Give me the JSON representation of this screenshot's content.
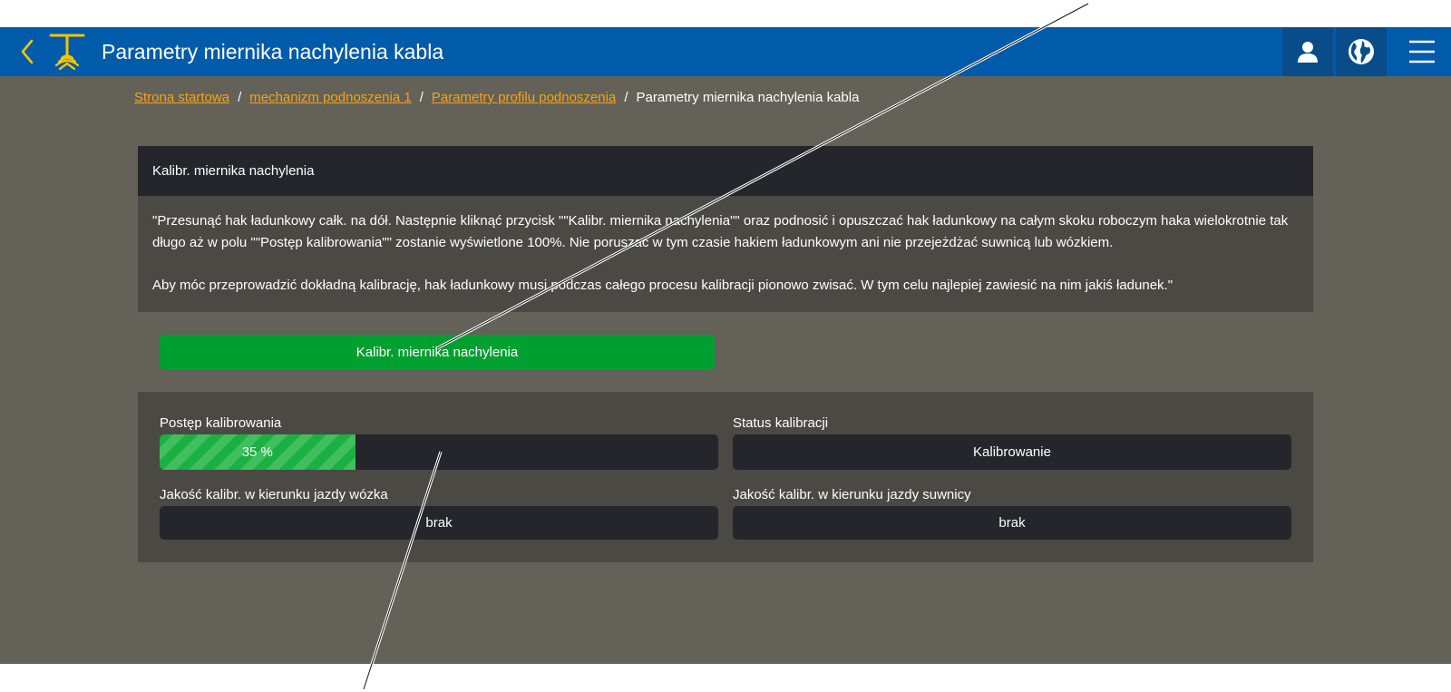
{
  "header": {
    "title": "Parametry miernika nachylenia kabla",
    "background_color": "#005baa",
    "icons": {
      "back": "chevron-left-icon",
      "logo": "crane-hook-icon",
      "user": "user-icon",
      "globe": "globe-icon",
      "menu": "hamburger-menu-icon"
    }
  },
  "breadcrumb": {
    "items": [
      "Strona startowa",
      "mechanizm podnoszenia 1",
      "Parametry profilu podnoszenia"
    ],
    "current": "Parametry miernika nachylenia kabla",
    "separator": "/",
    "link_color": "#f2a41d"
  },
  "info_card": {
    "title": "Kalibr. miernika nachylenia",
    "paragraph1": "\"Przesunąć hak ładunkowy całk. na dół. Następnie kliknąć przycisk \"\"Kalibr. miernika nachylenia\"\" oraz podnosić i opuszczać hak ładunkowy na całym skoku roboczym haka wielokrotnie tak długo aż w polu \"\"Postęp kalibrowania\"\" zostanie wyświetlone 100%. Nie poruszać w tym czasie hakiem ładunkowym ani nie przejeżdżać suwnicą lub wózkiem.",
    "paragraph2": "Aby móc przeprowadzić dokładną kalibrację, hak ładunkowy musi podczas całego procesu kalibracji pionowo zwisać. W tym celu najlepiej zawiesić na nim jakiś ładunek.\""
  },
  "calibrate_button": {
    "label": "Kalibr. miernika nachylenia",
    "color": "#00a030"
  },
  "status": {
    "progress_label": "Postęp kalibrowania",
    "progress_percent": 35,
    "progress_text": "35 %",
    "status_label": "Status kalibracji",
    "status_value": "Kalibrowanie",
    "trolley_quality_label": "Jakość kalibr. w kierunku jazdy wózka",
    "trolley_quality_value": "brak",
    "crane_quality_label": "Jakość kalibr. w kierunku jazdy suwnicy",
    "crane_quality_value": "brak"
  }
}
